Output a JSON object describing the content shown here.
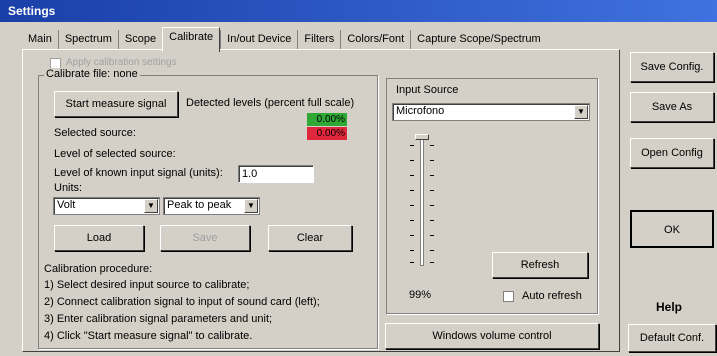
{
  "window": {
    "title": "Settings"
  },
  "tabs": [
    "Main",
    "Spectrum",
    "Scope",
    "Calibrate",
    "In/out Device",
    "Filters",
    "Colors/Font",
    "Capture Scope/Spectrum"
  ],
  "active_tab": "Calibrate",
  "calibrate": {
    "apply_label": "Apply calibration settings",
    "file_label": "Calibrate file: none",
    "start_button": "Start measure signal",
    "detected_label": "Detected levels (percent full scale)",
    "level_green": "0.00%",
    "level_red": "0.00%",
    "selected_source_label": "Selected source:",
    "level_selected_label": "Level of selected source:",
    "known_input_label": "Level of known input signal (units):",
    "known_input_value": "1.0",
    "units_label": "Units:",
    "units_value": "Volt",
    "measure_value": "Peak to peak",
    "load_button": "Load",
    "save_button": "Save",
    "clear_button": "Clear",
    "procedure_title": "Calibration procedure:",
    "procedure_steps": [
      "1) Select desired input source to calibrate;",
      "2) Connect calibration signal to input of sound card (left);",
      "3) Enter calibration signal parameters and unit;",
      "4) Click \"Start measure signal\" to calibrate."
    ]
  },
  "input_source": {
    "title": "Input Source",
    "device": "Microfono",
    "volume": "99%",
    "refresh_button": "Refresh",
    "auto_refresh_label": "Auto refresh",
    "windows_volume_button": "Windows volume control"
  },
  "side_buttons": {
    "save_config": "Save Config.",
    "save_as": "Save As",
    "open_config": "Open Config",
    "ok": "OK",
    "help": "Help",
    "default_conf": "Default Conf."
  },
  "colors": {
    "title_bar": "#1a3fa8",
    "level_green": "#2fa836",
    "level_red": "#e0283c"
  }
}
